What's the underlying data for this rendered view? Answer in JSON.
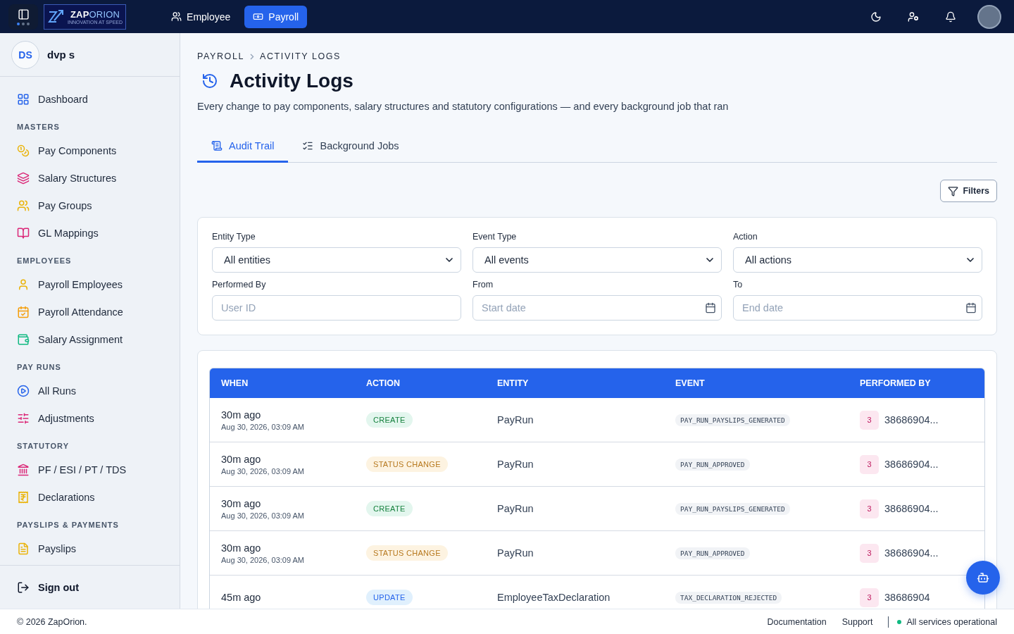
{
  "topbar": {
    "logo": {
      "text": "**ZAP**ORION",
      "tagline": "INNOVATION AT SPEED"
    },
    "nav": [
      {
        "label": "Employee",
        "selected": false
      },
      {
        "label": "Payroll",
        "selected": true
      }
    ]
  },
  "user": {
    "initials": "DS",
    "name": "dvp s"
  },
  "sidebar": {
    "sections": [
      {
        "items": [
          {
            "label": "Dashboard",
            "color": "#2563eb"
          }
        ]
      },
      {
        "heading": "MASTERS",
        "items": [
          {
            "label": "Pay Components",
            "color": "#eab308"
          },
          {
            "label": "Salary Structures",
            "color": "#db2777"
          },
          {
            "label": "Pay Groups",
            "color": "#eab308"
          },
          {
            "label": "GL Mappings",
            "color": "#db2777"
          }
        ]
      },
      {
        "heading": "EMPLOYEES",
        "items": [
          {
            "label": "Payroll Employees",
            "color": "#eab308"
          },
          {
            "label": "Payroll Attendance",
            "color": "#f59e0b"
          },
          {
            "label": "Salary Assignment",
            "color": "#10b981"
          }
        ]
      },
      {
        "heading": "PAY RUNS",
        "items": [
          {
            "label": "All Runs",
            "color": "#2563eb"
          },
          {
            "label": "Adjustments",
            "color": "#db2777"
          }
        ]
      },
      {
        "heading": "STATUTORY",
        "items": [
          {
            "label": "PF / ESI / PT / TDS",
            "color": "#db2777"
          },
          {
            "label": "Declarations",
            "color": "#eab308"
          }
        ]
      },
      {
        "heading": "PAYSLIPS & PAYMENTS",
        "items": [
          {
            "label": "Payslips",
            "color": "#eab308"
          }
        ]
      }
    ],
    "sign_out": "Sign out"
  },
  "breadcrumb": [
    "PAYROLL",
    "ACTIVITY LOGS"
  ],
  "title": "Activity Logs",
  "subtitle": "Every change to pay components, salary structures and statutory configurations — and every background job that ran",
  "tabs": [
    {
      "label": "Audit Trail",
      "selected": true
    },
    {
      "label": "Background Jobs",
      "selected": false
    }
  ],
  "filters_button": "Filters",
  "filters": [
    {
      "label": "Entity Type",
      "kind": "select",
      "value": "All entities"
    },
    {
      "label": "Event Type",
      "kind": "select",
      "value": "All events"
    },
    {
      "label": "Action",
      "kind": "select",
      "value": "All actions"
    },
    {
      "label": "Performed By",
      "kind": "text",
      "placeholder": "User ID"
    },
    {
      "label": "From",
      "kind": "date",
      "placeholder": "Start date"
    },
    {
      "label": "To",
      "kind": "date",
      "placeholder": "End date"
    }
  ],
  "table": {
    "columns": [
      "WHEN",
      "ACTION",
      "ENTITY",
      "EVENT",
      "PERFORMED BY"
    ],
    "rows": [
      {
        "when": "30m ago",
        "timestamp": "Aug 30, 2026, 03:09 AM",
        "action": {
          "label": "CREATE",
          "kind": "create"
        },
        "entity": "PayRun",
        "event": "PAY_RUN_PAYSLIPS_GENERATED",
        "badge": "3",
        "performer": "38686904..."
      },
      {
        "when": "30m ago",
        "timestamp": "Aug 30, 2026, 03:09 AM",
        "action": {
          "label": "STATUS CHANGE",
          "kind": "status_change"
        },
        "entity": "PayRun",
        "event": "PAY_RUN_APPROVED",
        "badge": "3",
        "performer": "38686904..."
      },
      {
        "when": "30m ago",
        "timestamp": "Aug 30, 2026, 03:09 AM",
        "action": {
          "label": "CREATE",
          "kind": "create"
        },
        "entity": "PayRun",
        "event": "PAY_RUN_PAYSLIPS_GENERATED",
        "badge": "3",
        "performer": "38686904..."
      },
      {
        "when": "30m ago",
        "timestamp": "Aug 30, 2026, 03:09 AM",
        "action": {
          "label": "STATUS CHANGE",
          "kind": "status_change"
        },
        "entity": "PayRun",
        "event": "PAY_RUN_APPROVED",
        "badge": "3",
        "performer": "38686904..."
      },
      {
        "when": "45m ago",
        "action": {
          "label": "UPDATE",
          "kind": "update"
        },
        "entity": "EmployeeTaxDeclaration",
        "event": "TAX_DECLARATION_REJECTED",
        "badge": "3",
        "performer": "38686904"
      }
    ]
  },
  "footer": {
    "copyright": "© 2026 ZapOrion.",
    "links": [
      "Documentation",
      "Support"
    ],
    "status": {
      "label": "All services operational",
      "color": "#10b981"
    }
  }
}
